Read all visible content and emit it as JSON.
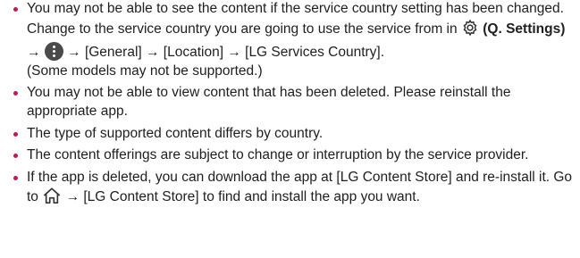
{
  "items": [
    {
      "line1": "You may not be able to see the content if the service country setting has been changed. Change to the service country you are going to use the service from in",
      "settings_label": "(Q. Settings)",
      "arrow": "→",
      "path": "[General] → [Location] → [LG Services Country].",
      "note": "(Some models may not be supported.)"
    },
    {
      "text": "You may not be able to view content that has been deleted. Please reinstall the appropriate app."
    },
    {
      "text": "The type of supported content differs by country."
    },
    {
      "text": "The content offerings are subject to change or interruption by the service provider."
    },
    {
      "before": "If the app is deleted, you can download the app at [LG Content Store] and re-install it. Go to",
      "after": "→ [LG Content Store] to find and install the app you want."
    }
  ],
  "colors": {
    "bullet": "#c2185b",
    "text": "#1f1f1f"
  },
  "icons": [
    "gear-icon",
    "more-dots-icon",
    "home-icon"
  ]
}
